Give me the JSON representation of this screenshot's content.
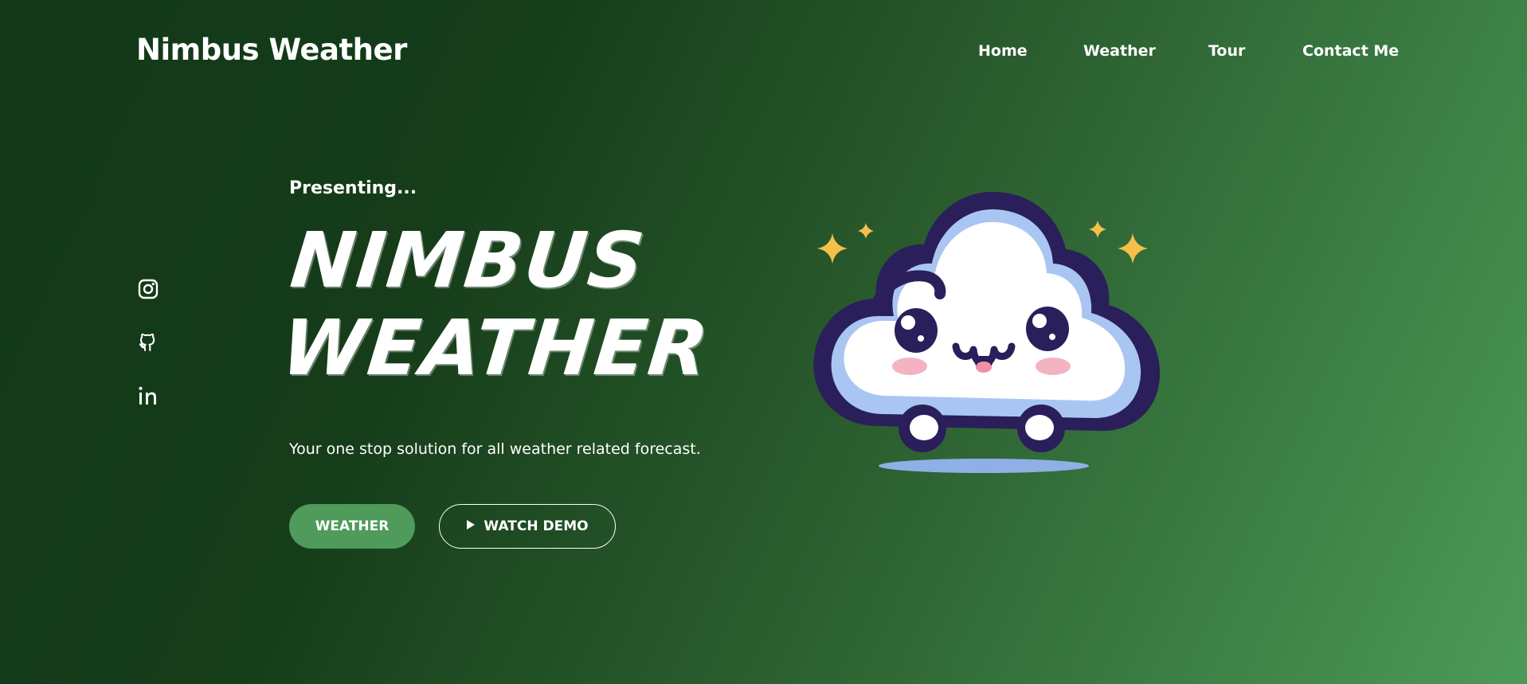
{
  "brand": "Nimbus Weather",
  "nav": {
    "items": [
      {
        "label": "Home"
      },
      {
        "label": "Weather"
      },
      {
        "label": "Tour"
      },
      {
        "label": "Contact Me"
      }
    ]
  },
  "social": {
    "icons": [
      "instagram-icon",
      "github-icon",
      "linkedin-icon"
    ]
  },
  "hero": {
    "eyebrow": "Presenting...",
    "title_line1": "NIMBUS",
    "title_line2": "WEATHER",
    "tagline": "Your one stop solution for all weather related forecast.",
    "primary_button": "WEATHER",
    "secondary_button": "WATCH DEMO",
    "secondary_button_icon": "play-icon"
  },
  "mascot": {
    "icon": "cloud-mascot-icon",
    "colors": {
      "outline": "#2a1f5a",
      "body": "#ffffff",
      "shade": "#a9c6f2",
      "blush": "#f4b3c2",
      "sparkle": "#f5c04a"
    }
  },
  "colors": {
    "accent": "#4e9b5b",
    "background_dark": "#123818",
    "background_light": "#4d9a58"
  }
}
